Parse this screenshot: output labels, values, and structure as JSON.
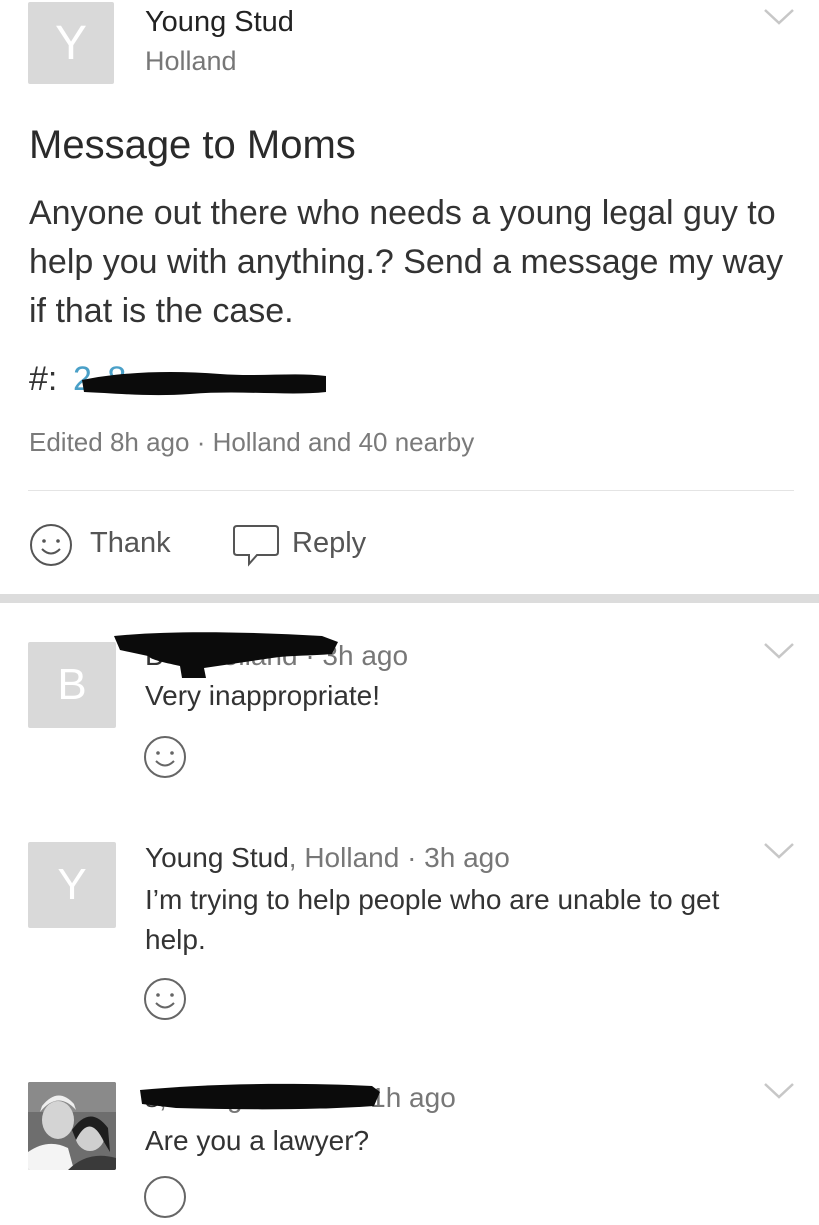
{
  "post": {
    "avatar_letter": "Y",
    "author": "Young Stud",
    "location": "Holland",
    "title": "Message to Moms",
    "body": "Anyone out there who needs a young legal guy to help you with anything.? Send a message my way if that is the case.",
    "phone_prefix": "#:",
    "phone_number": "2      8",
    "meta": "Edited 8h ago · Holland and 40 nearby",
    "actions": {
      "thank_label": "Thank",
      "reply_label": "Reply"
    }
  },
  "comments": [
    {
      "avatar_letter": "B",
      "name": "B              d",
      "place_time": ", Holland · 3h ago",
      "text": "Very inappropriate!"
    },
    {
      "avatar_letter": "Y",
      "name": "Young Stud",
      "place_time": ", Holland · 3h ago",
      "text": "I’m trying to help people who are unable to get help."
    },
    {
      "avatar": "photo",
      "name": "                    s",
      "place_time": ", Village Shires · 1h ago",
      "text": "Are you a lawyer?"
    }
  ],
  "colors": {
    "link": "#4aa0c8",
    "avatar_bg": "#d9d9d9",
    "divider": "#dcdcdc"
  },
  "icons": [
    "chevron-down-icon",
    "smiley-icon",
    "speech-bubble-icon"
  ]
}
